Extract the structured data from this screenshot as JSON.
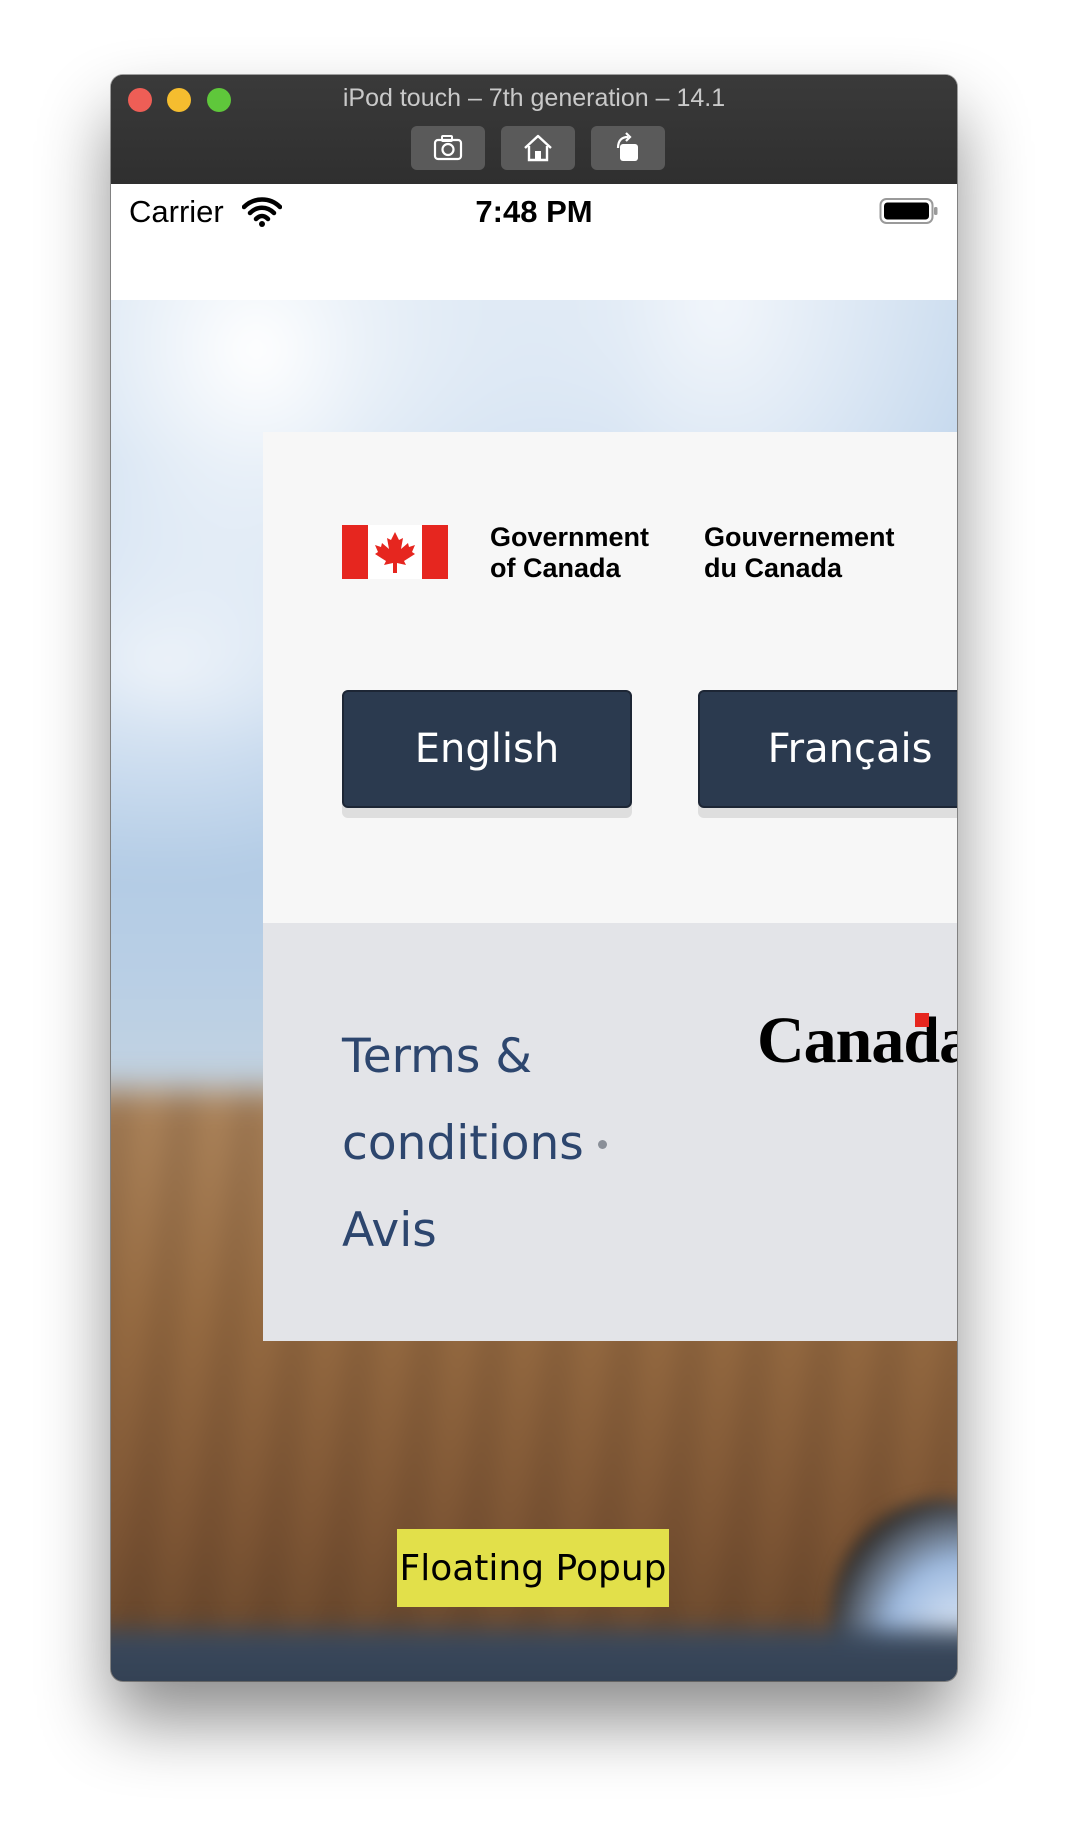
{
  "window": {
    "title": "iPod touch – 7th generation – 14.1",
    "toolbar": [
      {
        "icon": "screenshot-icon"
      },
      {
        "icon": "home-icon"
      },
      {
        "icon": "rotate-icon"
      }
    ]
  },
  "statusbar": {
    "carrier": "Carrier",
    "time": "7:48 PM"
  },
  "signature": {
    "en_line1": "Government",
    "en_line2": "of Canada",
    "fr_line1": "Gouvernement",
    "fr_line2": "du Canada"
  },
  "language": {
    "english": "English",
    "french": "Français"
  },
  "footer": {
    "terms_line1": "Terms &",
    "terms_line2": "conditions",
    "terms_line3": "Avis",
    "wordmark": "Canada"
  },
  "popup": {
    "label": "Floating Popup"
  },
  "colors": {
    "button_bg": "#2b3a4f",
    "link": "#2d466e",
    "popup_bg": "#e2e04a",
    "flag_red": "#e6261f"
  }
}
